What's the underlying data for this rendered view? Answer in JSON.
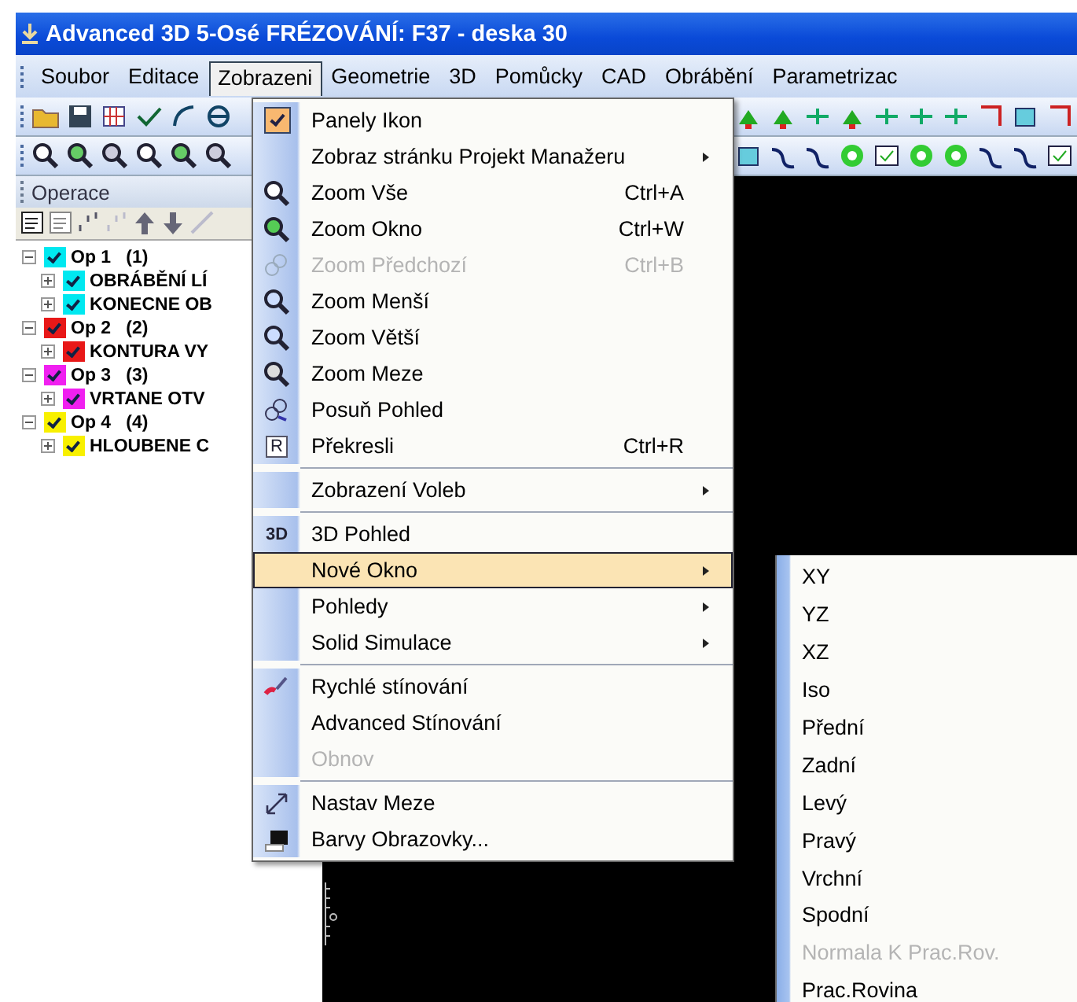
{
  "window": {
    "title": "Advanced 3D 5-Osé FRÉZOVÁNÍ: F37 - deska 30"
  },
  "menubar": [
    {
      "label": "Soubor",
      "selected": false
    },
    {
      "label": "Editace",
      "selected": false
    },
    {
      "label": "Zobrazeni",
      "selected": true
    },
    {
      "label": "Geometrie",
      "selected": false
    },
    {
      "label": "3D",
      "selected": false
    },
    {
      "label": "Pomůcky",
      "selected": false
    },
    {
      "label": "CAD",
      "selected": false
    },
    {
      "label": "Obrábění",
      "selected": false
    },
    {
      "label": "Parametrizac",
      "selected": false
    }
  ],
  "operations_panel": {
    "title": "Operace",
    "tree": [
      {
        "label": "Op 1   (1)",
        "color": "#00e8f0",
        "checked": true,
        "expanded": true,
        "children": [
          {
            "label": "OBRÁBĚNÍ LÍ",
            "color": "#00e8f0",
            "checked": true,
            "expanded": false
          },
          {
            "label": "KONECNE OB",
            "color": "#00e8f0",
            "checked": true,
            "expanded": false
          }
        ]
      },
      {
        "label": "Op 2   (2)",
        "color": "#e81818",
        "checked": true,
        "expanded": true,
        "children": [
          {
            "label": "KONTURA VY",
            "color": "#e81818",
            "checked": true,
            "expanded": false
          }
        ]
      },
      {
        "label": "Op 3   (3)",
        "color": "#f020f0",
        "checked": true,
        "expanded": true,
        "children": [
          {
            "label": "VRTANE OTV",
            "color": "#f020f0",
            "checked": true,
            "expanded": false
          }
        ]
      },
      {
        "label": "Op 4   (4)",
        "color": "#f8f000",
        "checked": true,
        "expanded": true,
        "children": [
          {
            "label": "HLOUBENE C",
            "color": "#f8f000",
            "checked": true,
            "expanded": false
          }
        ]
      }
    ]
  },
  "menu": {
    "items": [
      {
        "kind": "item",
        "label": "Panely Ikon",
        "checked": true,
        "disabled": false,
        "selected": false,
        "submenu": false
      },
      {
        "kind": "item",
        "label": "Zobraz stránku Projekt Manažeru",
        "disabled": false,
        "selected": false,
        "submenu": true
      },
      {
        "kind": "item",
        "label": "Zoom Vše",
        "shortcut": "Ctrl+A",
        "disabled": false,
        "selected": false,
        "submenu": false
      },
      {
        "kind": "item",
        "label": "Zoom Okno",
        "shortcut": "Ctrl+W",
        "disabled": false,
        "selected": false,
        "submenu": false
      },
      {
        "kind": "item",
        "label": "Zoom Předchozí",
        "shortcut": "Ctrl+B",
        "disabled": true,
        "selected": false,
        "submenu": false
      },
      {
        "kind": "item",
        "label": "Zoom Menší",
        "disabled": false,
        "selected": false,
        "submenu": false
      },
      {
        "kind": "item",
        "label": "Zoom Větší",
        "disabled": false,
        "selected": false,
        "submenu": false
      },
      {
        "kind": "item",
        "label": "Zoom Meze",
        "disabled": false,
        "selected": false,
        "submenu": false
      },
      {
        "kind": "item",
        "label": "Posuň Pohled",
        "disabled": false,
        "selected": false,
        "submenu": false
      },
      {
        "kind": "item",
        "label": "Překresli",
        "shortcut": "Ctrl+R",
        "icon_text": "R",
        "disabled": false,
        "selected": false,
        "submenu": false
      },
      {
        "kind": "separator"
      },
      {
        "kind": "item",
        "label": "Zobrazení Voleb",
        "disabled": false,
        "selected": false,
        "submenu": true
      },
      {
        "kind": "separator"
      },
      {
        "kind": "item",
        "label": "3D Pohled",
        "icon_text": "3D",
        "disabled": false,
        "selected": false,
        "submenu": false
      },
      {
        "kind": "item",
        "label": "Nové Okno",
        "disabled": false,
        "selected": true,
        "submenu": true
      },
      {
        "kind": "item",
        "label": "Pohledy",
        "disabled": false,
        "selected": false,
        "submenu": true
      },
      {
        "kind": "item",
        "label": "Solid Simulace",
        "disabled": false,
        "selected": false,
        "submenu": true
      },
      {
        "kind": "separator"
      },
      {
        "kind": "item",
        "label": "Rychlé stínování",
        "disabled": false,
        "selected": false,
        "submenu": false
      },
      {
        "kind": "item",
        "label": "Advanced Stínování",
        "disabled": false,
        "selected": false,
        "submenu": false
      },
      {
        "kind": "item",
        "label": "Obnov",
        "disabled": true,
        "selected": false,
        "submenu": false
      },
      {
        "kind": "separator"
      },
      {
        "kind": "item",
        "label": "Nastav Meze",
        "disabled": false,
        "selected": false,
        "submenu": false
      },
      {
        "kind": "item",
        "label": "Barvy Obrazovky...",
        "disabled": false,
        "selected": false,
        "submenu": false
      }
    ]
  },
  "submenu": {
    "items": [
      {
        "label": "XY",
        "disabled": false
      },
      {
        "label": "YZ",
        "disabled": false
      },
      {
        "label": "XZ",
        "disabled": false
      },
      {
        "label": "Iso",
        "disabled": false
      },
      {
        "label": "Přední",
        "disabled": false
      },
      {
        "label": "Zadní",
        "disabled": false
      },
      {
        "label": "Levý",
        "disabled": false
      },
      {
        "label": "Pravý",
        "disabled": false
      },
      {
        "label": "Vrchní",
        "disabled": false
      },
      {
        "label": "Spodní",
        "disabled": false
      },
      {
        "label": "Normala K Prac.Rov.",
        "disabled": true
      },
      {
        "label": "Prac.Rovina",
        "disabled": false
      }
    ]
  }
}
